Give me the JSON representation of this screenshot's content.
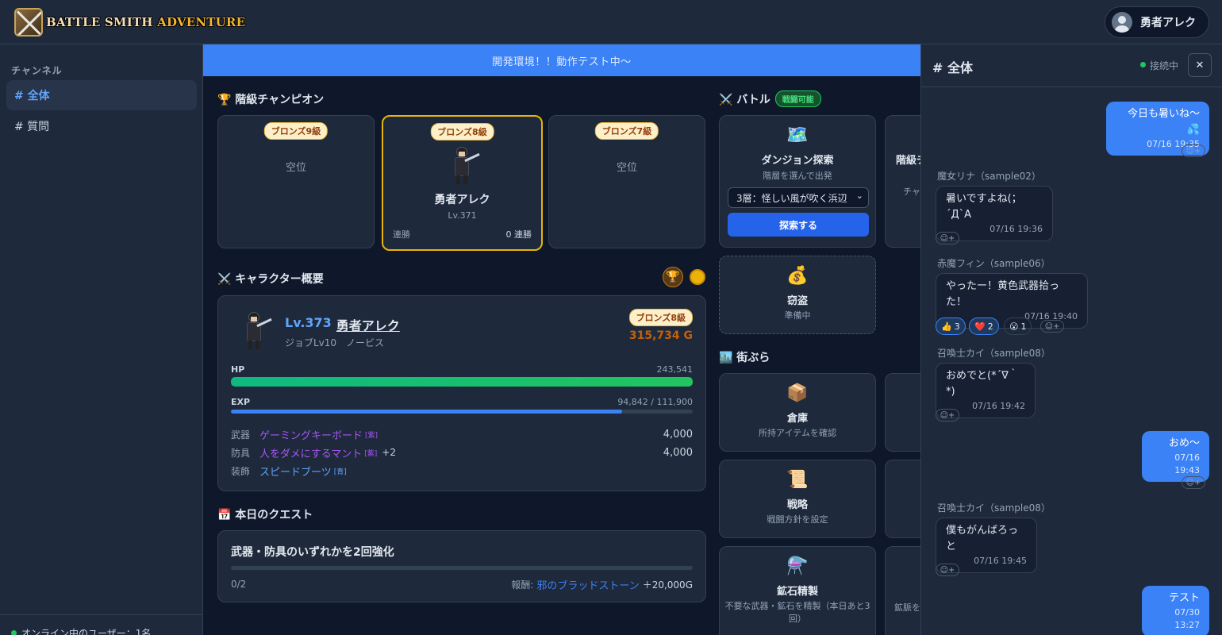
{
  "header": {
    "logo_part1": "BATTLE SMITH ",
    "logo_part2": "ADVENTURE",
    "user_name": "勇者アレク"
  },
  "sidebar": {
    "heading": "チャンネル",
    "channels": [
      {
        "label": "# 全体",
        "active": true
      },
      {
        "label": "# 質問",
        "active": false
      }
    ],
    "online_text": "オンライン中のユーザー：1名"
  },
  "banner": "開発環境！！動作テスト中〜",
  "champions": {
    "title": "🏆 階級チャンピオン",
    "slots": [
      {
        "rank": "ブロンズ9級",
        "vacant": "空位"
      },
      {
        "rank": "ブロンズ8級",
        "name": "勇者アレク",
        "level": "Lv.371",
        "streak_label": "連勝",
        "streak_value": "0 連勝"
      },
      {
        "rank": "ブロンズ7級",
        "vacant": "空位"
      }
    ]
  },
  "character": {
    "title": "⚔️ キャラクター概要",
    "level": "Lv.373",
    "name": "勇者アレク",
    "job": "ジョブLv10　ノービス",
    "rank": "ブロンズ8級",
    "gold": "315,734 G",
    "hp_label": "HP",
    "hp_value": "243,541",
    "hp_fraction": 1.0,
    "exp_label": "EXP",
    "exp_value": "94,842 / 111,900",
    "exp_fraction": 0.8476,
    "equipment": [
      {
        "slot": "武器",
        "name": "ゲーミングキーボード",
        "tag": "[紫]",
        "plus": "",
        "value": "4,000"
      },
      {
        "slot": "防具",
        "name": "人をダメにするマント",
        "tag": "[紫]",
        "plus": "+2",
        "value": "4,000"
      },
      {
        "slot": "装飾",
        "name": "スピードブーツ",
        "tag": "[青]",
        "plus": "",
        "value": ""
      }
    ]
  },
  "quest": {
    "title": "📅 本日のクエスト",
    "name": "武器・防具のいずれかを2回強化",
    "progress": "0/2",
    "progress_fraction": 0,
    "reward_label": "報酬:",
    "reward_item": "邪のブラッドストーン",
    "reward_gold": "＋20,000G"
  },
  "battle": {
    "title": "⚔️ バトル",
    "status": "戦闘可能",
    "dungeon": {
      "title": "ダンジョン探索",
      "desc": "階層を選んで出発",
      "selected_floor": "3層：怪しい風が吹く浜辺",
      "button": "探索する"
    },
    "partial_tile_title": "階級チ",
    "partial_tile_desc": "チャ",
    "steal": {
      "title": "窃盗",
      "desc": "準備中"
    }
  },
  "town": {
    "title": "🏙️ 街ぶら",
    "tiles": [
      {
        "title": "倉庫",
        "desc": "所持アイテムを確認"
      },
      {
        "title": "戦略",
        "desc": "戦闘方針を設定"
      },
      {
        "title": "鉱石精製",
        "desc": "不要な武器・鉱石を精製（本日あと3回）"
      }
    ],
    "partial_desc": "鉱脈を"
  },
  "chat": {
    "title": "# 全体",
    "status": "接続中",
    "messages": [
      {
        "author": "",
        "text": "今日も暑いね〜💦",
        "time": "07/16 19:35",
        "mine": true
      },
      {
        "author": "魔女リナ（sample02）",
        "text": "暑いですよね(；´Д`A",
        "time": "07/16 19:36",
        "mine": false
      },
      {
        "author": "赤魔フィン（sample06）",
        "text": "やったー！黄色武器拾った！",
        "time": "07/16 19:40",
        "mine": false,
        "reactions": [
          {
            "emoji": "👍",
            "count": "3"
          },
          {
            "emoji": "❤️",
            "count": "2"
          },
          {
            "emoji": "😮",
            "count": "1"
          }
        ]
      },
      {
        "author": "召喚士カイ（sample08）",
        "text": "おめでと(*´∇｀*)",
        "time": "07/16 19:42",
        "mine": false
      },
      {
        "author": "",
        "text": "おめ〜",
        "time": "07/16 19:43",
        "mine": true
      },
      {
        "author": "召喚士カイ（sample08）",
        "text": "僕もがんばろっと",
        "time": "07/16 19:45",
        "mine": false
      },
      {
        "author": "",
        "text": "テスト",
        "time": "07/30 13:27",
        "mine": true
      }
    ],
    "react_add": "☺+"
  }
}
